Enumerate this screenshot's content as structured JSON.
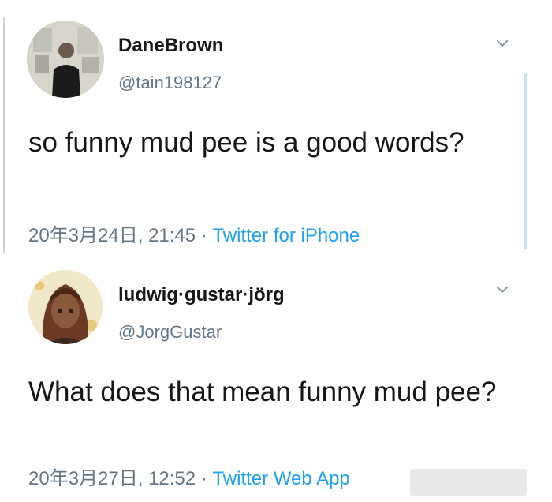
{
  "tweets": [
    {
      "display_name": "DaneBrown",
      "handle": "@tain198127",
      "text": "so funny mud pee is a good words?",
      "timestamp": "20年3月24日, 21:45",
      "separator": " · ",
      "source": "Twitter for iPhone",
      "avatar_icon": "user-photo-avatar",
      "menu_icon": "chevron-down-icon"
    },
    {
      "display_name": "ludwig·gustar·jörg",
      "handle": "@JorgGustar",
      "text": "What does that mean funny mud pee?",
      "timestamp": "20年3月27日, 12:52",
      "separator": " · ",
      "source": "Twitter Web App",
      "avatar_icon": "anime-character-avatar",
      "menu_icon": "chevron-down-icon"
    }
  ],
  "colors": {
    "text_primary": "#14171a",
    "text_secondary": "#657786",
    "link": "#1da1f2",
    "divider": "#e6ecf0"
  }
}
